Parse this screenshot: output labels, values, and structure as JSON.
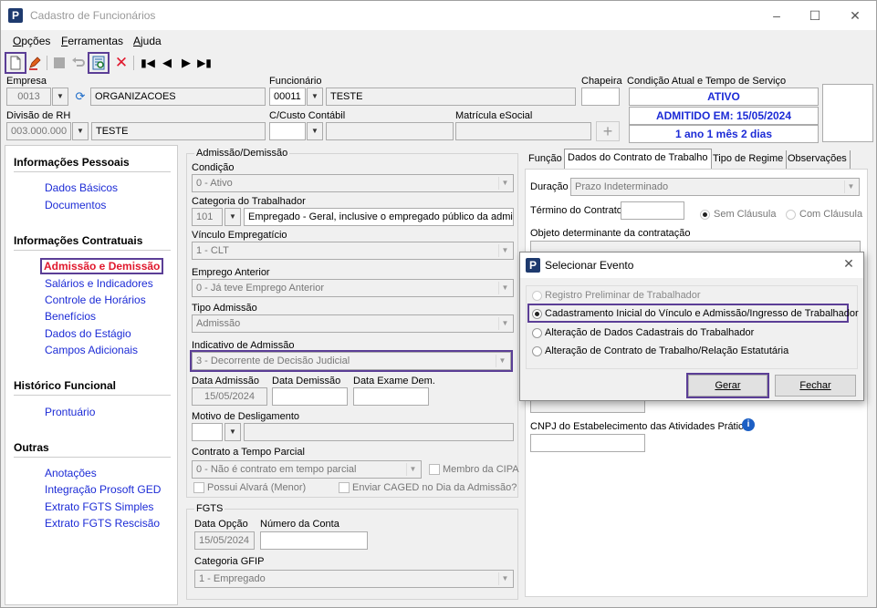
{
  "window": {
    "title": "Cadastro de Funcionários",
    "app_icon": "P"
  },
  "menu": [
    "Opções",
    "Ferramentas",
    "Ajuda"
  ],
  "header": {
    "empresa_label": "Empresa",
    "empresa_code": "0013",
    "empresa_name": "ORGANIZACOES",
    "funcionario_label": "Funcionário",
    "funcionario_code": "00011",
    "funcionario_name": "TESTE",
    "chapeira_label": "Chapeira",
    "chapeira_value": "",
    "divisao_label": "Divisão de RH",
    "divisao_code": "003.000.000",
    "divisao_name": "TESTE",
    "custo_label": "C/Custo Contábil",
    "custo_value": "",
    "matricula_label": "Matrícula eSocial",
    "matricula_value": "",
    "condicao_label": "Condição Atual e Tempo de Serviço",
    "status_1": "ATIVO",
    "status_2": "ADMITIDO EM: 15/05/2024",
    "status_3": "1 ano 1 mês 2 dias",
    "status_color": "#1c2bd6"
  },
  "nav": {
    "sections": [
      {
        "title": "Informações Pessoais",
        "items": [
          "Dados Básicos",
          "Documentos"
        ]
      },
      {
        "title": "Informações Contratuais",
        "items": [
          "Admissão e Demissão",
          "Salários e Indicadores",
          "Controle de Horários",
          "Benefícios",
          "Dados do Estágio",
          "Campos Adicionais"
        ]
      },
      {
        "title": "Histórico Funcional",
        "items": [
          "Prontuário"
        ]
      },
      {
        "title": "Outras",
        "items": [
          "Anotações",
          "Integração Prosoft GED",
          "Extrato FGTS Simples",
          "Extrato FGTS Rescisão"
        ]
      }
    ],
    "active": "Admissão e Demissão",
    "link_color": "#1c2bd6",
    "active_color": "#e0182d"
  },
  "admissao": {
    "group_title": "Admissão/Demissão",
    "condicao_label": "Condição",
    "condicao_value": "0 - Ativo",
    "categoria_label": "Categoria do Trabalhador",
    "categoria_code": "101",
    "categoria_name": "Empregado - Geral, inclusive o empregado público da administ",
    "vinculo_label": "Vínculo Empregatício",
    "vinculo_value": "1 - CLT",
    "emprego_label": "Emprego Anterior",
    "emprego_value": "0 - Já teve Emprego Anterior",
    "tipo_label": "Tipo Admissão",
    "tipo_value": "Admissão",
    "indicativo_label": "Indicativo de Admissão",
    "indicativo_value": "3 - Decorrente de Decisão Judicial",
    "data_adm_label": "Data Admissão",
    "data_adm_value": "15/05/2024",
    "data_dem_label": "Data Demissão",
    "data_exame_label": "Data Exame Dem.",
    "motivo_label": "Motivo de Desligamento",
    "parcial_label": "Contrato a Tempo Parcial",
    "parcial_value": "0 - Não é contrato em tempo parcial",
    "cipa_label": "Membro da CIPA",
    "alvara_label": "Possui Alvará (Menor)",
    "caged_label": "Enviar CAGED no Dia da Admissão?"
  },
  "fgts": {
    "group_title": "FGTS",
    "data_opcao_label": "Data Opção",
    "data_opcao_value": "15/05/2024",
    "conta_label": "Número da Conta",
    "gfip_label": "Categoria GFIP",
    "gfip_value": "1 - Empregado"
  },
  "tabs": [
    "Função",
    "Dados do Contrato de Trabalho",
    "Tipo de Regime",
    "Observações"
  ],
  "contrato": {
    "duracao_label": "Duração",
    "duracao_value": "Prazo Indeterminado",
    "termino_label": "Término do Contrato",
    "sem_clausula": "Sem Cláusula",
    "com_clausula": "Com Cláusula",
    "objeto_label": "Objeto determinante da contratação",
    "cnpj_label": "CNPJ do Estabelecimento das Atividades Práticas"
  },
  "dialog": {
    "title": "Selecionar Evento",
    "options": [
      "Registro Preliminar de Trabalhador",
      "Cadastramento Inicial do Vínculo e Admissão/Ingresso de Trabalhador",
      "Alteração de Dados Cadastrais do Trabalhador",
      "Alteração de Contrato de Trabalho/Relação Estatutária"
    ],
    "selected_index": 1,
    "gerar": "Gerar",
    "fechar": "Fechar"
  },
  "highlight_color": "#5b3e96"
}
